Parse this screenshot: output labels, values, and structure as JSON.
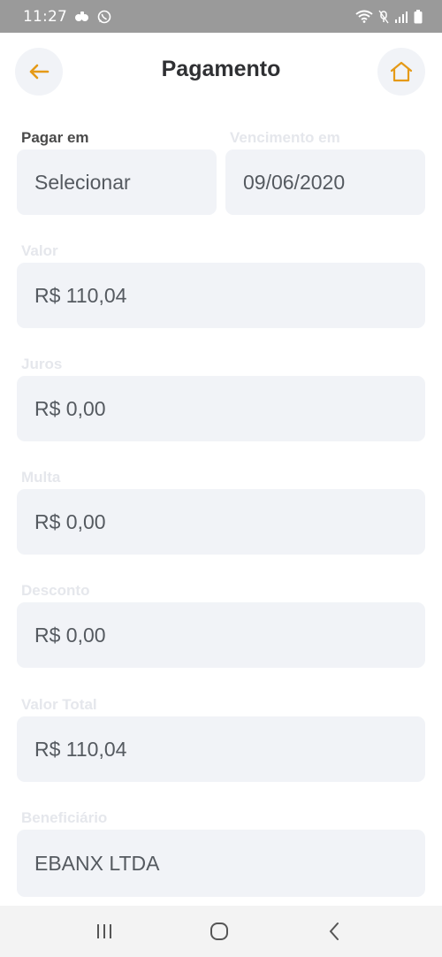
{
  "status_bar": {
    "time": "11:27",
    "icons": [
      "notification-leaf-icon",
      "whatsapp-icon",
      "wifi-icon",
      "silent-icon",
      "signal-icon",
      "battery-icon"
    ]
  },
  "header": {
    "title": "Pagamento",
    "back_icon": "arrow-left-icon",
    "home_icon": "home-icon",
    "accent_color": "#e59a17"
  },
  "form": {
    "pay_on": {
      "label": "Pagar em",
      "value": "Selecionar"
    },
    "due_date": {
      "label": "Vencimento em",
      "value": "09/06/2020"
    },
    "amount": {
      "label": "Valor",
      "value": "R$ 110,04"
    },
    "interest": {
      "label": "Juros",
      "value": "R$ 0,00"
    },
    "fine": {
      "label": "Multa",
      "value": "R$ 0,00"
    },
    "discount": {
      "label": "Desconto",
      "value": "R$ 0,00"
    },
    "total": {
      "label": "Valor Total",
      "value": "R$ 110,04"
    },
    "beneficiary": {
      "label": "Beneficiário",
      "value": "EBANX LTDA"
    }
  },
  "nav_bar": {
    "icons": [
      "recent-apps-icon",
      "home-button-icon",
      "back-button-icon"
    ]
  }
}
